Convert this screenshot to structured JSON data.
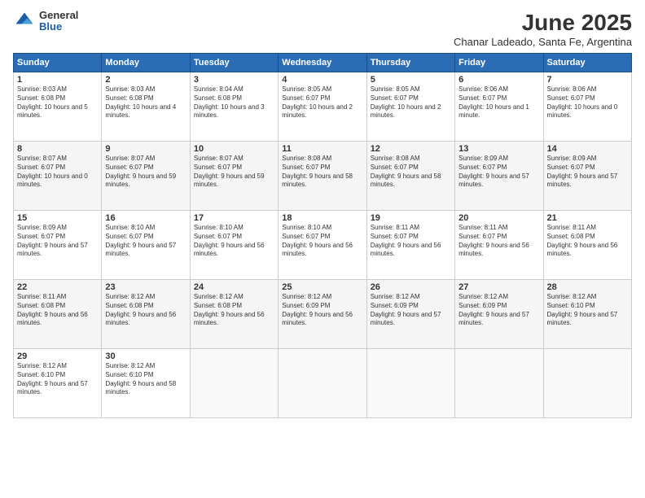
{
  "logo": {
    "general": "General",
    "blue": "Blue"
  },
  "title": "June 2025",
  "subtitle": "Chanar Ladeado, Santa Fe, Argentina",
  "headers": [
    "Sunday",
    "Monday",
    "Tuesday",
    "Wednesday",
    "Thursday",
    "Friday",
    "Saturday"
  ],
  "weeks": [
    [
      {
        "day": "1",
        "sunrise": "8:03 AM",
        "sunset": "6:08 PM",
        "daylight": "10 hours and 5 minutes."
      },
      {
        "day": "2",
        "sunrise": "8:03 AM",
        "sunset": "6:08 PM",
        "daylight": "10 hours and 4 minutes."
      },
      {
        "day": "3",
        "sunrise": "8:04 AM",
        "sunset": "6:08 PM",
        "daylight": "10 hours and 3 minutes."
      },
      {
        "day": "4",
        "sunrise": "8:05 AM",
        "sunset": "6:07 PM",
        "daylight": "10 hours and 2 minutes."
      },
      {
        "day": "5",
        "sunrise": "8:05 AM",
        "sunset": "6:07 PM",
        "daylight": "10 hours and 2 minutes."
      },
      {
        "day": "6",
        "sunrise": "8:06 AM",
        "sunset": "6:07 PM",
        "daylight": "10 hours and 1 minute."
      },
      {
        "day": "7",
        "sunrise": "8:06 AM",
        "sunset": "6:07 PM",
        "daylight": "10 hours and 0 minutes."
      }
    ],
    [
      {
        "day": "8",
        "sunrise": "8:07 AM",
        "sunset": "6:07 PM",
        "daylight": "10 hours and 0 minutes."
      },
      {
        "day": "9",
        "sunrise": "8:07 AM",
        "sunset": "6:07 PM",
        "daylight": "9 hours and 59 minutes."
      },
      {
        "day": "10",
        "sunrise": "8:07 AM",
        "sunset": "6:07 PM",
        "daylight": "9 hours and 59 minutes."
      },
      {
        "day": "11",
        "sunrise": "8:08 AM",
        "sunset": "6:07 PM",
        "daylight": "9 hours and 58 minutes."
      },
      {
        "day": "12",
        "sunrise": "8:08 AM",
        "sunset": "6:07 PM",
        "daylight": "9 hours and 58 minutes."
      },
      {
        "day": "13",
        "sunrise": "8:09 AM",
        "sunset": "6:07 PM",
        "daylight": "9 hours and 57 minutes."
      },
      {
        "day": "14",
        "sunrise": "8:09 AM",
        "sunset": "6:07 PM",
        "daylight": "9 hours and 57 minutes."
      }
    ],
    [
      {
        "day": "15",
        "sunrise": "8:09 AM",
        "sunset": "6:07 PM",
        "daylight": "9 hours and 57 minutes."
      },
      {
        "day": "16",
        "sunrise": "8:10 AM",
        "sunset": "6:07 PM",
        "daylight": "9 hours and 57 minutes."
      },
      {
        "day": "17",
        "sunrise": "8:10 AM",
        "sunset": "6:07 PM",
        "daylight": "9 hours and 56 minutes."
      },
      {
        "day": "18",
        "sunrise": "8:10 AM",
        "sunset": "6:07 PM",
        "daylight": "9 hours and 56 minutes."
      },
      {
        "day": "19",
        "sunrise": "8:11 AM",
        "sunset": "6:07 PM",
        "daylight": "9 hours and 56 minutes."
      },
      {
        "day": "20",
        "sunrise": "8:11 AM",
        "sunset": "6:07 PM",
        "daylight": "9 hours and 56 minutes."
      },
      {
        "day": "21",
        "sunrise": "8:11 AM",
        "sunset": "6:08 PM",
        "daylight": "9 hours and 56 minutes."
      }
    ],
    [
      {
        "day": "22",
        "sunrise": "8:11 AM",
        "sunset": "6:08 PM",
        "daylight": "9 hours and 56 minutes."
      },
      {
        "day": "23",
        "sunrise": "8:12 AM",
        "sunset": "6:08 PM",
        "daylight": "9 hours and 56 minutes."
      },
      {
        "day": "24",
        "sunrise": "8:12 AM",
        "sunset": "6:08 PM",
        "daylight": "9 hours and 56 minutes."
      },
      {
        "day": "25",
        "sunrise": "8:12 AM",
        "sunset": "6:09 PM",
        "daylight": "9 hours and 56 minutes."
      },
      {
        "day": "26",
        "sunrise": "8:12 AM",
        "sunset": "6:09 PM",
        "daylight": "9 hours and 57 minutes."
      },
      {
        "day": "27",
        "sunrise": "8:12 AM",
        "sunset": "6:09 PM",
        "daylight": "9 hours and 57 minutes."
      },
      {
        "day": "28",
        "sunrise": "8:12 AM",
        "sunset": "6:10 PM",
        "daylight": "9 hours and 57 minutes."
      }
    ],
    [
      {
        "day": "29",
        "sunrise": "8:12 AM",
        "sunset": "6:10 PM",
        "daylight": "9 hours and 57 minutes."
      },
      {
        "day": "30",
        "sunrise": "8:12 AM",
        "sunset": "6:10 PM",
        "daylight": "9 hours and 58 minutes."
      },
      null,
      null,
      null,
      null,
      null
    ]
  ]
}
